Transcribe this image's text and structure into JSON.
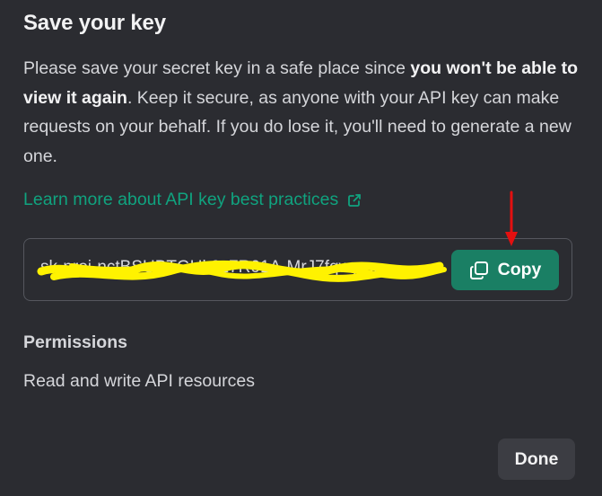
{
  "dialog": {
    "title": "Save your key",
    "description": {
      "part1": "Please save your secret key in a safe place since ",
      "bold": "you won't be able to view it again",
      "part2": ". Keep it secure, as anyone with your API key can make requests on your behalf. If you do lose it, you'll need to generate a new one."
    },
    "learn_more_label": "Learn more about API key best practices",
    "learn_more_icon": "external-link-icon",
    "key": {
      "value": "sk-proj-nctBSUBTGUk2z7R01A-MrJ7fqwyoc"
    },
    "copy_button": {
      "label": "Copy",
      "icon": "copy-icon",
      "color": "#1a7f64"
    },
    "permissions": {
      "heading": "Permissions",
      "value": "Read and write API resources"
    },
    "done_label": "Done"
  },
  "colors": {
    "background": "#2b2c31",
    "link": "#10a37f",
    "redaction": "#fff200",
    "annotation_arrow": "#e31010"
  }
}
